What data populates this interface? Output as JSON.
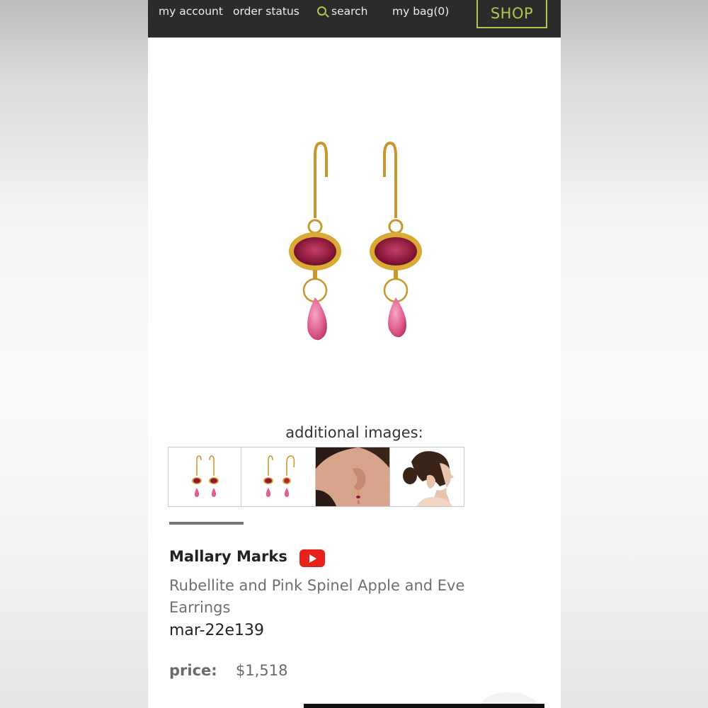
{
  "header": {
    "my_account": "my account",
    "order_status": "order status",
    "search": "search",
    "my_bag": "my bag(0)",
    "shop": "SHOP"
  },
  "gallery": {
    "label": "additional images:"
  },
  "product": {
    "brand": "Mallary Marks",
    "title": "Rubellite and Pink Spinel Apple and Eve Earrings",
    "sku": "mar-22e139",
    "price_label": "price:",
    "price": "$1,518"
  },
  "colors": {
    "accent": "#b8c24a",
    "header_bg": "#2b2b2b",
    "youtube_red": "#e62117"
  }
}
